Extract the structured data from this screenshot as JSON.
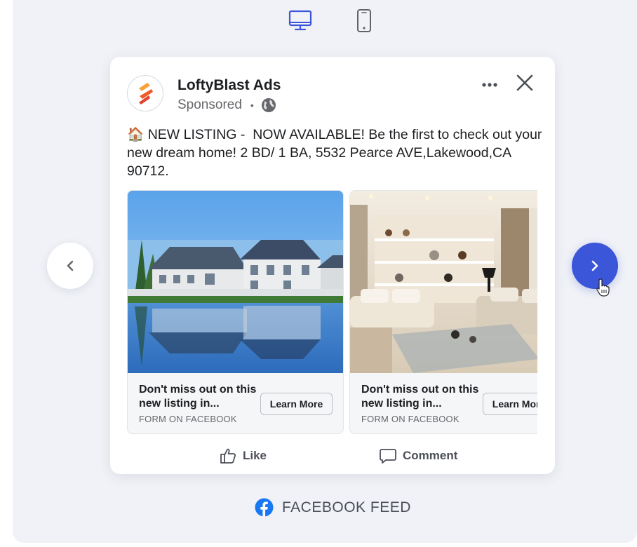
{
  "preview_toggle": {
    "desktop_icon": "desktop-monitor-icon",
    "mobile_icon": "mobile-phone-icon",
    "active": "desktop",
    "active_color": "#3b56d9"
  },
  "ad": {
    "page_name": "LoftyBlast Ads",
    "sponsored_label": "Sponsored",
    "separator": "•",
    "post_text": "🏠 NEW LISTING -  NOW AVAILABLE! Be the first to check out your new dream home! 2 BD/ 1 BA, 5532 Pearce AVE,Lakewood,CA 90712.",
    "carousel": [
      {
        "headline": "Don't miss out on this new listing in...",
        "source": "FORM ON FACEBOOK",
        "cta": "Learn More",
        "image": "house-exterior-waterfront-photo"
      },
      {
        "headline": "Don't miss out on this new listing in...",
        "source": "FORM ON FACEBOOK",
        "cta": "Learn More",
        "image": "living-room-interior-photo"
      }
    ],
    "actions": {
      "like": "Like",
      "comment": "Comment"
    }
  },
  "placement": {
    "label": "FACEBOOK FEED",
    "icon": "facebook-logo-icon",
    "brand_color": "#1877f2"
  },
  "colors": {
    "accent": "#3b56d9",
    "logo_orange": "#f0592a"
  }
}
